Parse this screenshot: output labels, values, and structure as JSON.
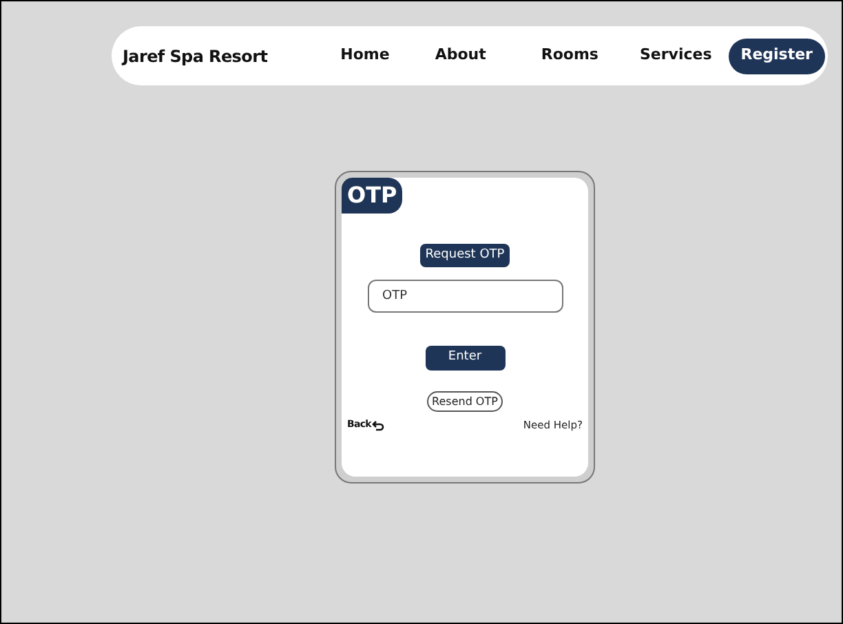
{
  "navbar": {
    "brand": "Jaref Spa Resort",
    "links": [
      {
        "label": "Home"
      },
      {
        "label": "About"
      },
      {
        "label": "Rooms"
      },
      {
        "label": "Services"
      }
    ],
    "register_button": "Register"
  },
  "otp_card": {
    "title": "OTP",
    "request_button": "Request OTP",
    "otp_field": {
      "placeholder": "OTP"
    },
    "enter_button": "Enter",
    "resend_button": "Resend OTP",
    "back_link": "Back",
    "help_link": "Need Help?"
  }
}
